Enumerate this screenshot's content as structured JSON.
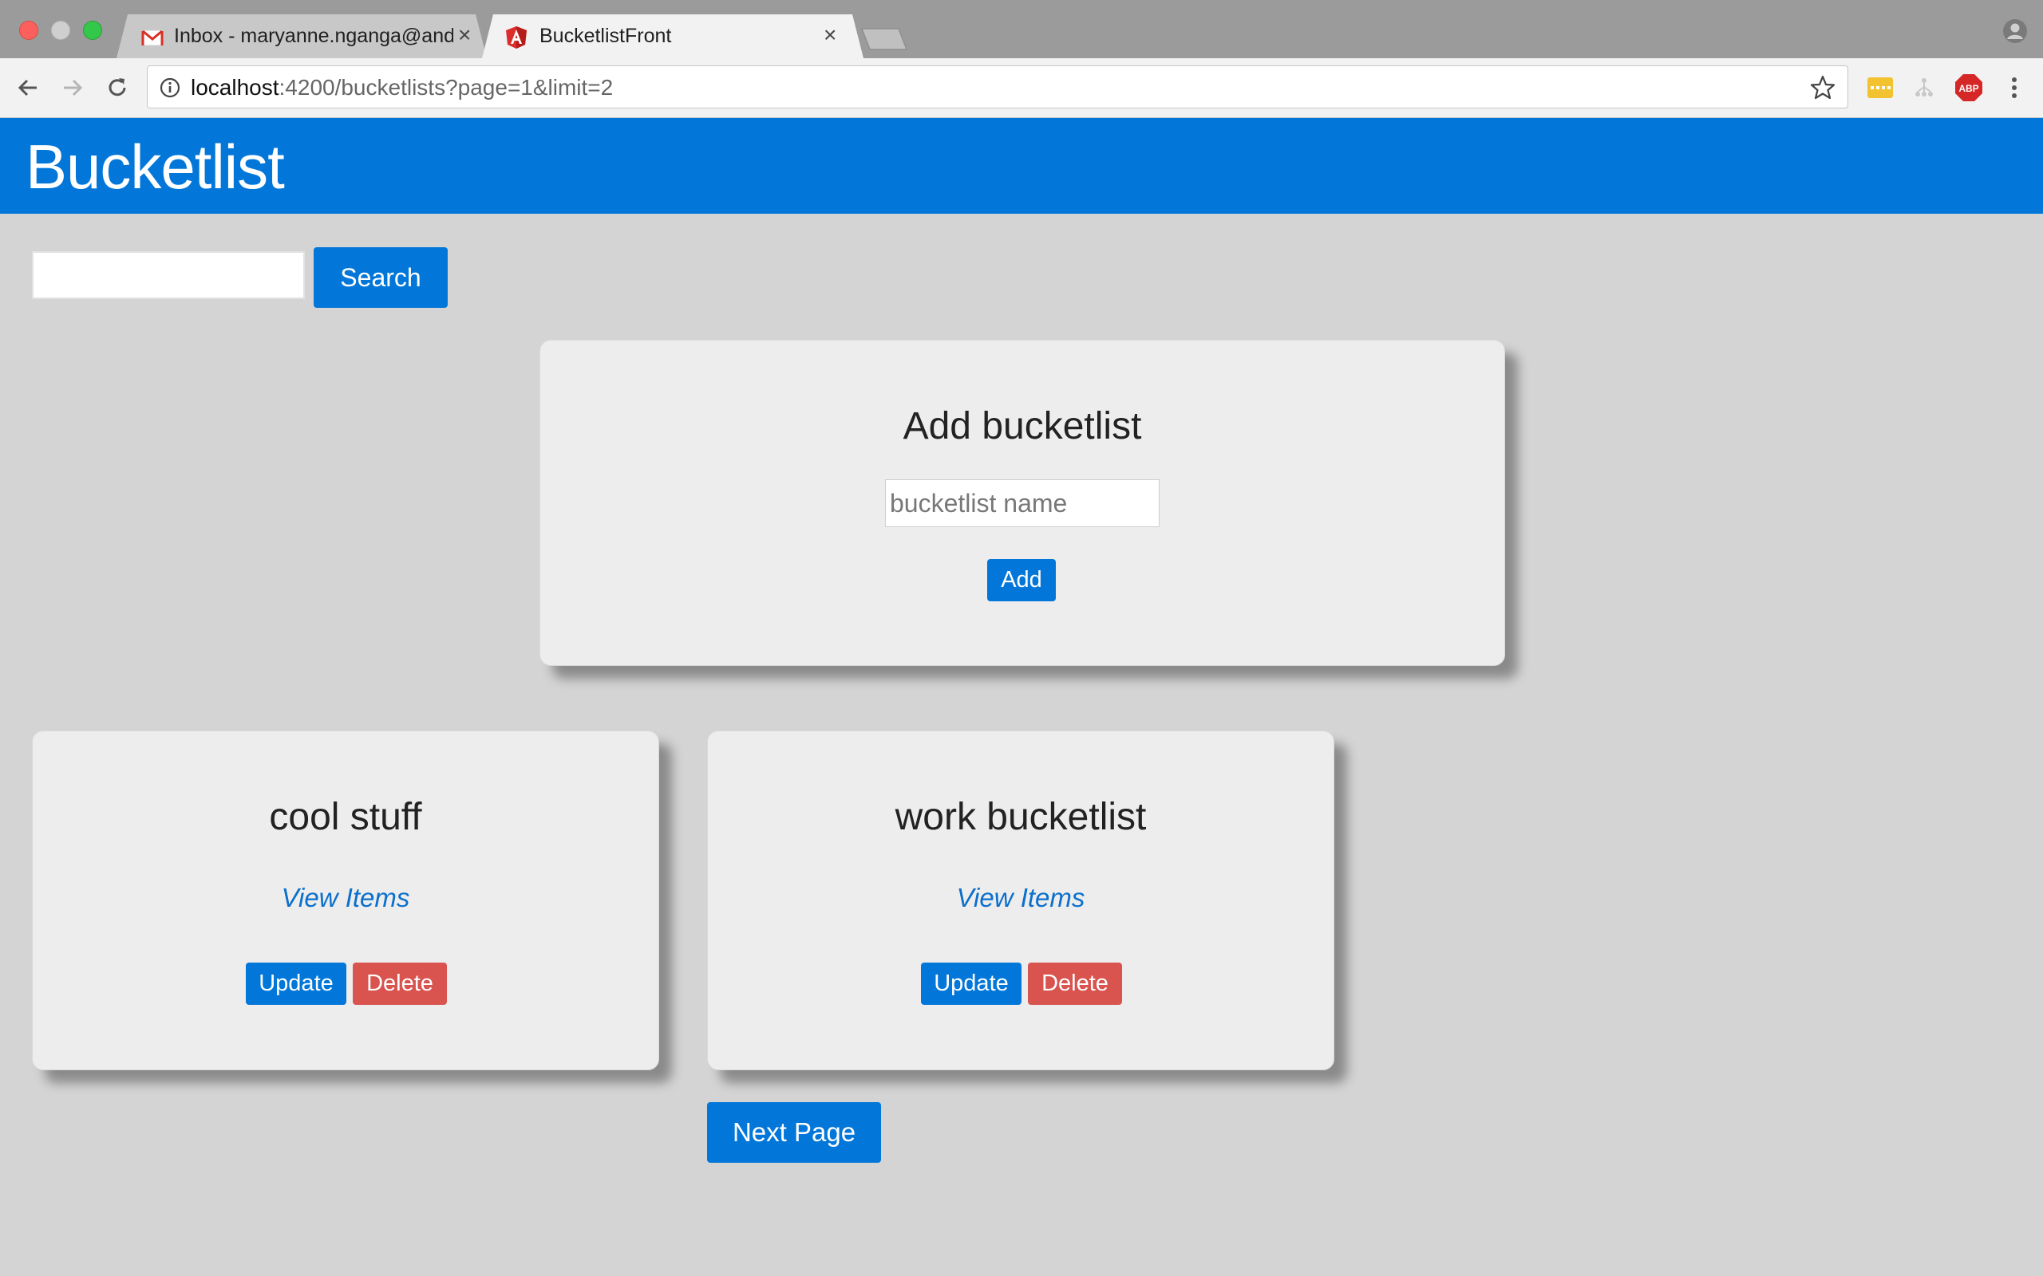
{
  "browser": {
    "tabs": [
      {
        "title": "Inbox - maryanne.nganga@andela.com",
        "favicon": "gmail-icon",
        "active": false
      },
      {
        "title": "BucketlistFront",
        "favicon": "angular-icon",
        "active": true
      }
    ],
    "url": {
      "host": "localhost",
      "path": ":4200/bucketlists?page=1&limit=2"
    },
    "extensions": [
      "password-manager-icon",
      "tree-extension-icon",
      "adblock-plus-icon"
    ]
  },
  "header": {
    "brand": "Bucketlist"
  },
  "search": {
    "value": "",
    "button_label": "Search"
  },
  "add_card": {
    "title": "Add bucketlist",
    "input_placeholder": "bucketlist name",
    "input_value": "",
    "button_label": "Add"
  },
  "bucketlists": [
    {
      "name": "cool stuff",
      "view_label": "View Items",
      "update_label": "Update",
      "delete_label": "Delete"
    },
    {
      "name": "work bucketlist",
      "view_label": "View Items",
      "update_label": "Update",
      "delete_label": "Delete"
    }
  ],
  "pagination": {
    "next_label": "Next Page"
  },
  "colors": {
    "primary": "#0277d9",
    "danger": "#d9534f",
    "page_bg": "#d4d4d4",
    "card_bg": "#ededed",
    "link": "#0b6fcc"
  }
}
